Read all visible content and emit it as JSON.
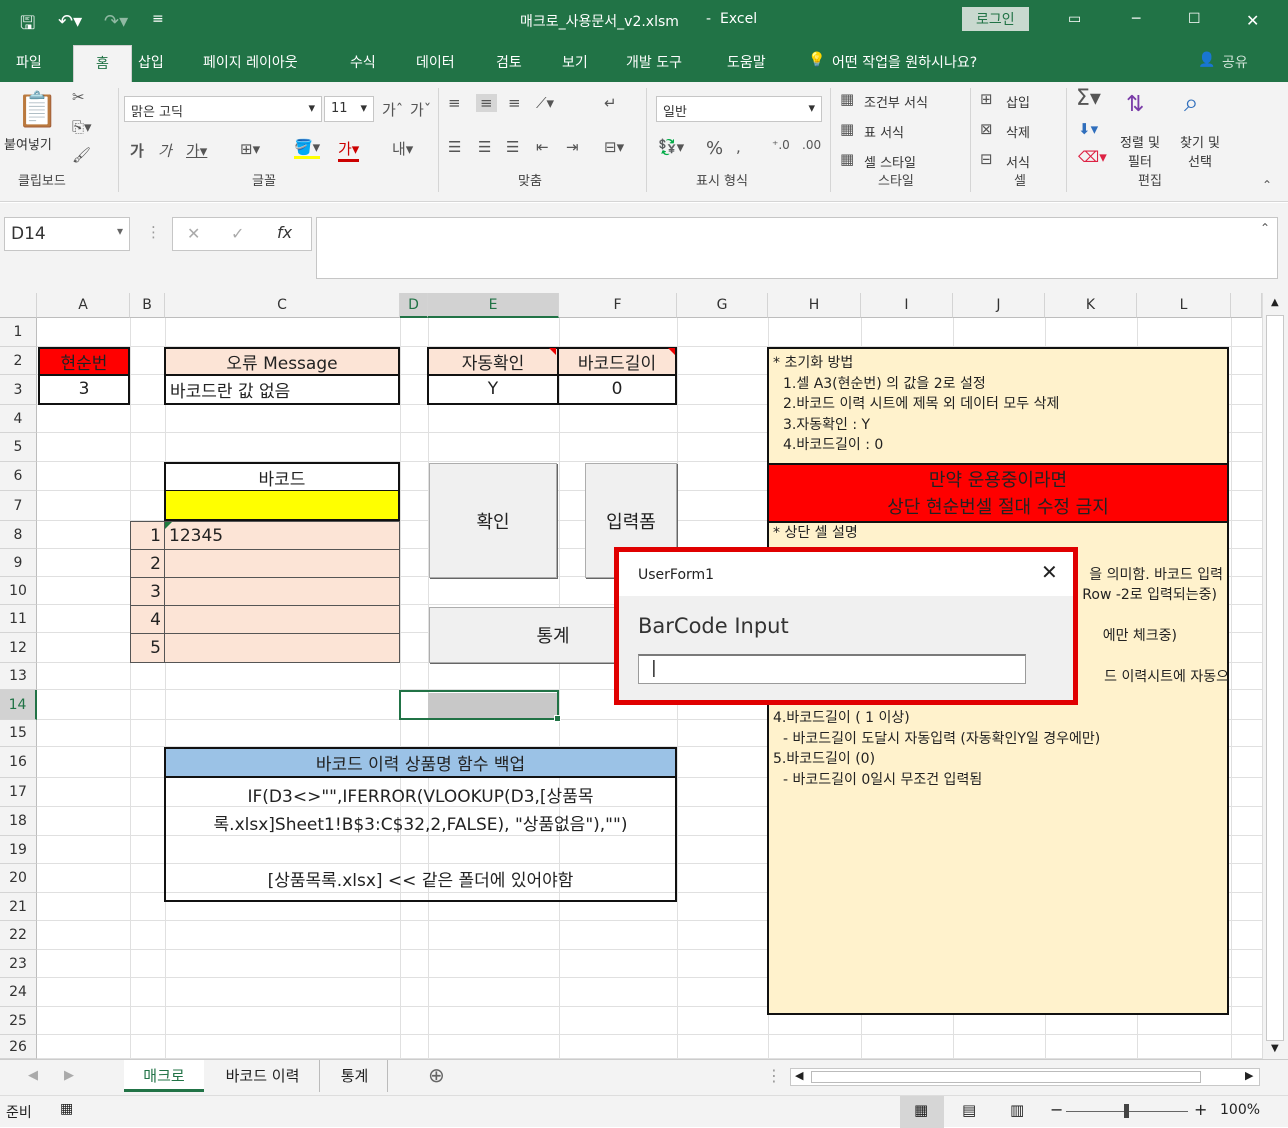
{
  "app": {
    "title": "매크로_사용문서_v2.xlsm",
    "separator": "-",
    "app_name": "Excel",
    "login": "로그인"
  },
  "ribbon_tabs": [
    "파일",
    "홈",
    "삽입",
    "페이지 레이아웃",
    "수식",
    "데이터",
    "검토",
    "보기",
    "개발 도구",
    "도움말"
  ],
  "tell_me": "어떤 작업을 원하시나요?",
  "share": "공유",
  "ribbon": {
    "paste": "붙여넣기",
    "clipboard": "클립보드",
    "font_name": "맑은 고딕",
    "font_size": "11",
    "font_group": "글꼴",
    "align_group": "맞춤",
    "number_format": "일반",
    "number_group": "표시 형식",
    "percent": "%",
    "cond_format": "조건부 서식",
    "table_format": "표 서식",
    "cell_style": "셀 스타일",
    "style_group": "스타일",
    "insert": "삽입",
    "delete": "삭제",
    "format": "서식",
    "cells_group": "셀",
    "sort_filter": "정렬 및\n필터",
    "find_select": "찾기 및\n선택",
    "edit_group": "편집"
  },
  "formula_bar": {
    "name_box": "D14",
    "formula": ""
  },
  "columns": [
    "A",
    "B",
    "C",
    "D",
    "E",
    "F",
    "G",
    "H",
    "I",
    "J",
    "K",
    "L"
  ],
  "rows": [
    "1",
    "2",
    "3",
    "4",
    "5",
    "6",
    "7",
    "8",
    "9",
    "10",
    "11",
    "12",
    "13",
    "14",
    "15",
    "16",
    "17",
    "18",
    "19",
    "20",
    "21",
    "22",
    "23",
    "24",
    "25",
    "26"
  ],
  "cells": {
    "a2": "현순번",
    "a3": "3",
    "c2": "오류 Message",
    "c3": "바코드란 값 없음",
    "e2": "자동확인",
    "e3": "Y",
    "f2": "바코드길이",
    "f3": "0",
    "c6": "바코드",
    "c7": "",
    "c8": "12345",
    "b8": "1",
    "b9": "2",
    "b10": "3",
    "b11": "4",
    "b12": "5",
    "backup_title": "바코드 이력 상품명 함수 백업",
    "backup_line1": "IF(D3<>\"\",IFERROR(VLOOKUP(D3,[상품목",
    "backup_line2": "록.xlsx]Sheet1!B$3:C$32,2,FALSE), \"상품없음\"),\"\")",
    "backup_line3": "[상품목록.xlsx] << 같은 폴더에 있어야함"
  },
  "buttons": {
    "confirm": "확인",
    "input_form": "입력폼",
    "stats": "통계"
  },
  "notes": {
    "init": [
      "* 초기화 방법",
      "1.셀 A3(현순번) 의 값을 2로 설정",
      "2.바코드 이력 시트에 제목 외 데이터 모두 삭제",
      "3.자동확인 : Y",
      "4.바코드길이 : 0"
    ],
    "warning_1": "만약 운용중이라면",
    "warning_2": "상단 현순번셀 절대 수정 금지",
    "desc": [
      "* 상단 셀 설명",
      "을 의미함. 바코드 입력",
      "Row -2로 입력되는중)",
      "에만 체크중)",
      "드 이력시트에 자동으",
      "4.바코드길이 ( 1 이상)",
      "- 바코드길이 도달시 자동입력 (자동확인Y일 경우에만)",
      "5.바코드길이 (0)",
      "- 바코드길이 0일시 무조건 입력됨"
    ]
  },
  "userform": {
    "title": "UserForm1",
    "label": "BarCode Input",
    "input_value": "|"
  },
  "sheet_tabs": [
    "매크로",
    "바코드 이력",
    "통계"
  ],
  "status": {
    "ready": "준비",
    "zoom": "100%"
  },
  "colors": {
    "excel_green": "#217346",
    "red": "#ff0000",
    "salmon": "#fce4d6",
    "yellow": "#ffff00",
    "cream": "#fff2cc",
    "blue_header": "#9bc2e6"
  }
}
